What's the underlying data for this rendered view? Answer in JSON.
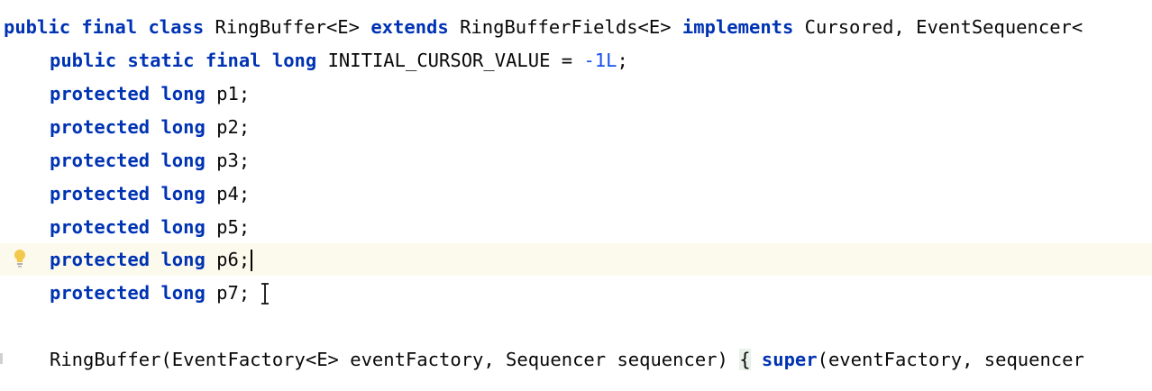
{
  "editor": {
    "lines": [
      {
        "id": "class-decl",
        "tokens": [
          {
            "t": "public",
            "c": "kw"
          },
          {
            "t": " ",
            "c": "plain"
          },
          {
            "t": "final",
            "c": "kw"
          },
          {
            "t": " ",
            "c": "plain"
          },
          {
            "t": "class",
            "c": "kw"
          },
          {
            "t": " RingBuffer<E> ",
            "c": "plain"
          },
          {
            "t": "extends",
            "c": "kw"
          },
          {
            "t": " RingBufferFields<E> ",
            "c": "plain"
          },
          {
            "t": "implements",
            "c": "kw"
          },
          {
            "t": " Cursored, EventSequencer<",
            "c": "plain"
          }
        ]
      },
      {
        "id": "initial-cursor-value",
        "tokens": [
          {
            "t": "public",
            "c": "kw"
          },
          {
            "t": " ",
            "c": "plain"
          },
          {
            "t": "static",
            "c": "kw"
          },
          {
            "t": " ",
            "c": "plain"
          },
          {
            "t": "final",
            "c": "kw"
          },
          {
            "t": " ",
            "c": "plain"
          },
          {
            "t": "long",
            "c": "kw"
          },
          {
            "t": " INITIAL_CURSOR_VALUE = ",
            "c": "plain"
          },
          {
            "t": "-1L",
            "c": "num"
          },
          {
            "t": ";",
            "c": "plain"
          }
        ]
      },
      {
        "id": "field-p1",
        "tokens": [
          {
            "t": "protected",
            "c": "kw"
          },
          {
            "t": " ",
            "c": "plain"
          },
          {
            "t": "long",
            "c": "kw"
          },
          {
            "t": " p1;",
            "c": "plain"
          }
        ]
      },
      {
        "id": "field-p2",
        "tokens": [
          {
            "t": "protected",
            "c": "kw"
          },
          {
            "t": " ",
            "c": "plain"
          },
          {
            "t": "long",
            "c": "kw"
          },
          {
            "t": " p2;",
            "c": "plain"
          }
        ]
      },
      {
        "id": "field-p3",
        "tokens": [
          {
            "t": "protected",
            "c": "kw"
          },
          {
            "t": " ",
            "c": "plain"
          },
          {
            "t": "long",
            "c": "kw"
          },
          {
            "t": " p3;",
            "c": "plain"
          }
        ]
      },
      {
        "id": "field-p4",
        "tokens": [
          {
            "t": "protected",
            "c": "kw"
          },
          {
            "t": " ",
            "c": "plain"
          },
          {
            "t": "long",
            "c": "kw"
          },
          {
            "t": " p4;",
            "c": "plain"
          }
        ]
      },
      {
        "id": "field-p5",
        "tokens": [
          {
            "t": "protected",
            "c": "kw"
          },
          {
            "t": " ",
            "c": "plain"
          },
          {
            "t": "long",
            "c": "kw"
          },
          {
            "t": " p5;",
            "c": "plain"
          }
        ]
      },
      {
        "id": "field-p6",
        "current": true,
        "caret": true,
        "tokens": [
          {
            "t": "protected",
            "c": "kw"
          },
          {
            "t": " ",
            "c": "plain"
          },
          {
            "t": "long",
            "c": "kw"
          },
          {
            "t": " p6;",
            "c": "plain"
          }
        ]
      },
      {
        "id": "field-p7",
        "tokens": [
          {
            "t": "protected",
            "c": "kw"
          },
          {
            "t": " ",
            "c": "plain"
          },
          {
            "t": "long",
            "c": "kw"
          },
          {
            "t": " p7;",
            "c": "plain"
          }
        ]
      },
      {
        "id": "blank",
        "tokens": []
      },
      {
        "id": "constructor",
        "tokens": [
          {
            "t": "RingBuffer(EventFactory<E> eventFactory, Sequencer sequencer) ",
            "c": "plain"
          },
          {
            "t": "{",
            "c": "brace"
          },
          {
            "t": " ",
            "c": "plain"
          },
          {
            "t": "super",
            "c": "kw"
          },
          {
            "t": "(eventFactory, sequencer",
            "c": "plain"
          }
        ]
      }
    ]
  },
  "colors": {
    "keyword": "#0033b3",
    "number": "#1750eb",
    "current_line": "#fcfaed",
    "bulb": "#f2c94c"
  },
  "icons": {
    "gutter": "lightbulb-icon",
    "mouse_cursor": "text-cursor-icon"
  }
}
